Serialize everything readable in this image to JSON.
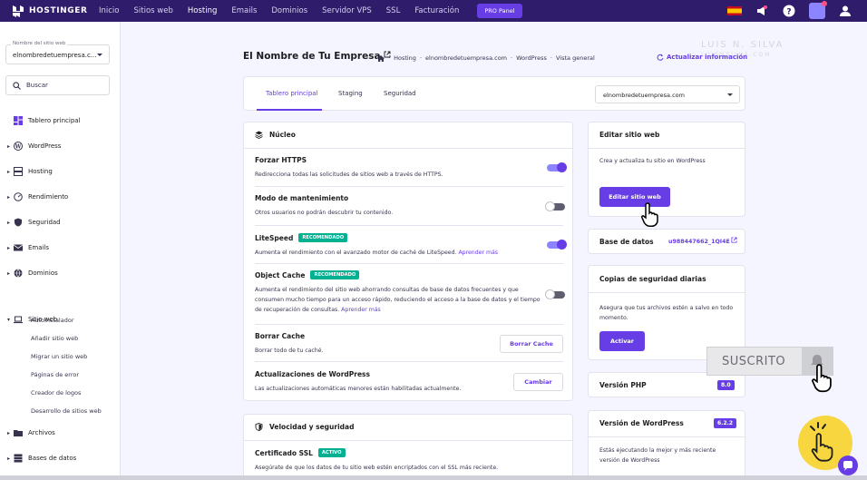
{
  "topbar": {
    "brand": "HOSTINGER",
    "nav": [
      "Inicio",
      "Sitios web",
      "Hosting",
      "Emails",
      "Dominios",
      "Servidor VPS",
      "SSL",
      "Facturación"
    ],
    "active_nav": "Hosting",
    "pro_panel": "PRO Panel"
  },
  "sidebar": {
    "site_select_label": "Nombre del sitio web",
    "site_select_value": "elnombredetuempresa.c...",
    "search_placeholder": "Buscar",
    "items": [
      {
        "label": "Tablero principal",
        "icon": "dashboard-icon"
      },
      {
        "label": "WordPress",
        "icon": "wordpress-icon"
      },
      {
        "label": "Hosting",
        "icon": "server-icon"
      },
      {
        "label": "Rendimiento",
        "icon": "gauge-icon"
      },
      {
        "label": "Seguridad",
        "icon": "shield-icon"
      },
      {
        "label": "Emails",
        "icon": "mail-icon"
      },
      {
        "label": "Dominios",
        "icon": "globe-icon"
      },
      {
        "label": "Sitio web",
        "icon": "laptop-icon"
      }
    ],
    "sub_items": [
      "Autoinstalador",
      "Añadir sitio web",
      "Migrar un sitio web",
      "Páginas de error",
      "Creador de logos",
      "Desarrollo de sitios web"
    ],
    "more_items": [
      {
        "label": "Archivos",
        "icon": "folder-icon"
      },
      {
        "label": "Bases de datos",
        "icon": "database-icon"
      }
    ]
  },
  "header": {
    "title": "El Nombre de Tu Empresa",
    "breadcrumb": [
      "Hosting",
      "elnombredetuempresa.com",
      "WordPress",
      "Vista general"
    ],
    "refresh": "Actualizar información"
  },
  "tabs": {
    "items": [
      "Tablero principal",
      "Staging",
      "Seguridad"
    ],
    "domain_select": "elnombredetuempresa.com"
  },
  "core": {
    "title": "Núcleo",
    "rows": [
      {
        "title": "Forzar HTTPS",
        "desc": "Redirecciona todas las solicitudes de sitios web a través de HTTPS.",
        "toggle": true
      },
      {
        "title": "Modo de mantenimiento",
        "desc": "Otros usuarios no podrán descubrir tu contenido.",
        "toggle": false
      },
      {
        "title": "LiteSpeed",
        "badge": "RECOMENDADO",
        "desc": "Aumenta el rendimiento con el avanzado motor de caché de LiteSpeed.",
        "link": "Aprender más",
        "toggle": true
      },
      {
        "title": "Object Cache",
        "badge": "RECOMENDADO",
        "desc": "Aumenta el rendimiento del sitio web ahorrando consultas de base de datos frecuentes y que consumen mucho tiempo para un acceso rápido, reduciendo el acceso a la base de datos y el tiempo de recuperación de consultas.",
        "link": "Aprender más",
        "toggle": false
      },
      {
        "title": "Borrar Cache",
        "desc": "Borrar todo de tu caché.",
        "button": "Borrar Cache"
      },
      {
        "title": "Actualizaciones de WordPress",
        "desc": "Las actualizaciones automáticas menores están habilitadas actualmente.",
        "button": "Cambiar"
      }
    ]
  },
  "security": {
    "title": "Velocidad y seguridad",
    "ssl_title": "Certificado SSL",
    "ssl_badge": "ACTIVO",
    "ssl_desc": "Asegúrate de que los datos de tu sitio web estén encriptados con el SSL más reciente."
  },
  "right": {
    "edit": {
      "title": "Editar sitio web",
      "desc": "Crea y actualiza tu sitio en WordPress",
      "button": "Editar sitio web"
    },
    "db": {
      "label": "Base de datos",
      "value": "u988447662_1QI4E"
    },
    "backups": {
      "title": "Copias de seguridad diarias",
      "desc": "Asegura que tus archivos estén a salvo en todo momento.",
      "button": "Activar"
    },
    "php": {
      "label": "Versión PHP",
      "value": "8.0"
    },
    "wp": {
      "label": "Versión de WordPress",
      "value": "6.2.2",
      "desc": "Estás ejecutando la mejor y más reciente versión de WordPress"
    }
  },
  "overlay": {
    "subscribed": "SUSCRITO",
    "watermark": "LUIS N. SILVA",
    "watermark_sub": "LUISNSILVA.COM"
  },
  "colors": {
    "brand": "#2f1c6a",
    "accent": "#673de6",
    "success": "#00b090"
  }
}
